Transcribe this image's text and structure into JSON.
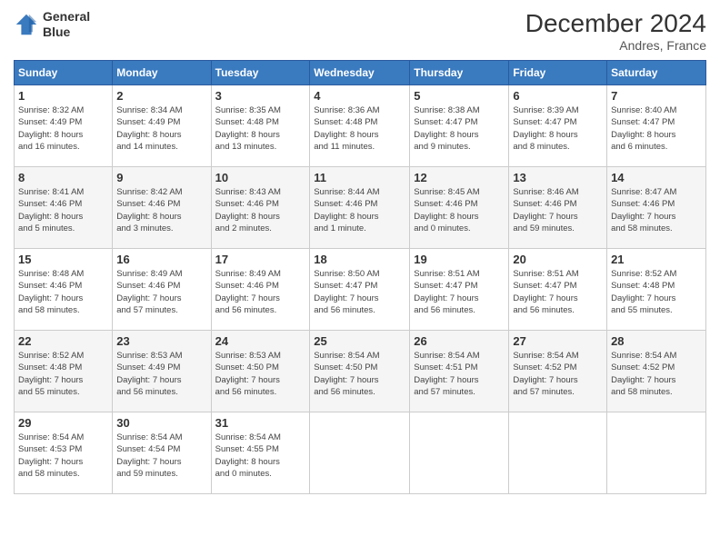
{
  "header": {
    "logo_line1": "General",
    "logo_line2": "Blue",
    "month_title": "December 2024",
    "location": "Andres, France"
  },
  "weekdays": [
    "Sunday",
    "Monday",
    "Tuesday",
    "Wednesday",
    "Thursday",
    "Friday",
    "Saturday"
  ],
  "weeks": [
    [
      {
        "day": "1",
        "info": "Sunrise: 8:32 AM\nSunset: 4:49 PM\nDaylight: 8 hours\nand 16 minutes."
      },
      {
        "day": "2",
        "info": "Sunrise: 8:34 AM\nSunset: 4:49 PM\nDaylight: 8 hours\nand 14 minutes."
      },
      {
        "day": "3",
        "info": "Sunrise: 8:35 AM\nSunset: 4:48 PM\nDaylight: 8 hours\nand 13 minutes."
      },
      {
        "day": "4",
        "info": "Sunrise: 8:36 AM\nSunset: 4:48 PM\nDaylight: 8 hours\nand 11 minutes."
      },
      {
        "day": "5",
        "info": "Sunrise: 8:38 AM\nSunset: 4:47 PM\nDaylight: 8 hours\nand 9 minutes."
      },
      {
        "day": "6",
        "info": "Sunrise: 8:39 AM\nSunset: 4:47 PM\nDaylight: 8 hours\nand 8 minutes."
      },
      {
        "day": "7",
        "info": "Sunrise: 8:40 AM\nSunset: 4:47 PM\nDaylight: 8 hours\nand 6 minutes."
      }
    ],
    [
      {
        "day": "8",
        "info": "Sunrise: 8:41 AM\nSunset: 4:46 PM\nDaylight: 8 hours\nand 5 minutes."
      },
      {
        "day": "9",
        "info": "Sunrise: 8:42 AM\nSunset: 4:46 PM\nDaylight: 8 hours\nand 3 minutes."
      },
      {
        "day": "10",
        "info": "Sunrise: 8:43 AM\nSunset: 4:46 PM\nDaylight: 8 hours\nand 2 minutes."
      },
      {
        "day": "11",
        "info": "Sunrise: 8:44 AM\nSunset: 4:46 PM\nDaylight: 8 hours\nand 1 minute."
      },
      {
        "day": "12",
        "info": "Sunrise: 8:45 AM\nSunset: 4:46 PM\nDaylight: 8 hours\nand 0 minutes."
      },
      {
        "day": "13",
        "info": "Sunrise: 8:46 AM\nSunset: 4:46 PM\nDaylight: 7 hours\nand 59 minutes."
      },
      {
        "day": "14",
        "info": "Sunrise: 8:47 AM\nSunset: 4:46 PM\nDaylight: 7 hours\nand 58 minutes."
      }
    ],
    [
      {
        "day": "15",
        "info": "Sunrise: 8:48 AM\nSunset: 4:46 PM\nDaylight: 7 hours\nand 58 minutes."
      },
      {
        "day": "16",
        "info": "Sunrise: 8:49 AM\nSunset: 4:46 PM\nDaylight: 7 hours\nand 57 minutes."
      },
      {
        "day": "17",
        "info": "Sunrise: 8:49 AM\nSunset: 4:46 PM\nDaylight: 7 hours\nand 56 minutes."
      },
      {
        "day": "18",
        "info": "Sunrise: 8:50 AM\nSunset: 4:47 PM\nDaylight: 7 hours\nand 56 minutes."
      },
      {
        "day": "19",
        "info": "Sunrise: 8:51 AM\nSunset: 4:47 PM\nDaylight: 7 hours\nand 56 minutes."
      },
      {
        "day": "20",
        "info": "Sunrise: 8:51 AM\nSunset: 4:47 PM\nDaylight: 7 hours\nand 56 minutes."
      },
      {
        "day": "21",
        "info": "Sunrise: 8:52 AM\nSunset: 4:48 PM\nDaylight: 7 hours\nand 55 minutes."
      }
    ],
    [
      {
        "day": "22",
        "info": "Sunrise: 8:52 AM\nSunset: 4:48 PM\nDaylight: 7 hours\nand 55 minutes."
      },
      {
        "day": "23",
        "info": "Sunrise: 8:53 AM\nSunset: 4:49 PM\nDaylight: 7 hours\nand 56 minutes."
      },
      {
        "day": "24",
        "info": "Sunrise: 8:53 AM\nSunset: 4:50 PM\nDaylight: 7 hours\nand 56 minutes."
      },
      {
        "day": "25",
        "info": "Sunrise: 8:54 AM\nSunset: 4:50 PM\nDaylight: 7 hours\nand 56 minutes."
      },
      {
        "day": "26",
        "info": "Sunrise: 8:54 AM\nSunset: 4:51 PM\nDaylight: 7 hours\nand 57 minutes."
      },
      {
        "day": "27",
        "info": "Sunrise: 8:54 AM\nSunset: 4:52 PM\nDaylight: 7 hours\nand 57 minutes."
      },
      {
        "day": "28",
        "info": "Sunrise: 8:54 AM\nSunset: 4:52 PM\nDaylight: 7 hours\nand 58 minutes."
      }
    ],
    [
      {
        "day": "29",
        "info": "Sunrise: 8:54 AM\nSunset: 4:53 PM\nDaylight: 7 hours\nand 58 minutes."
      },
      {
        "day": "30",
        "info": "Sunrise: 8:54 AM\nSunset: 4:54 PM\nDaylight: 7 hours\nand 59 minutes."
      },
      {
        "day": "31",
        "info": "Sunrise: 8:54 AM\nSunset: 4:55 PM\nDaylight: 8 hours\nand 0 minutes."
      },
      null,
      null,
      null,
      null
    ]
  ]
}
